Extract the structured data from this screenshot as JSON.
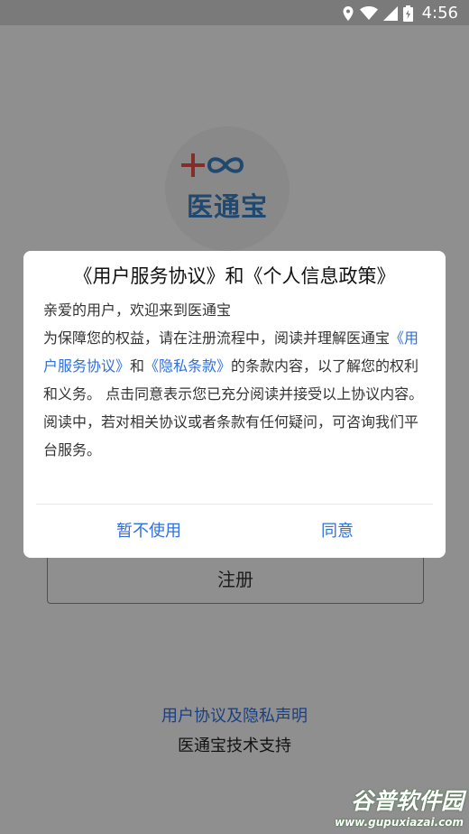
{
  "status_bar": {
    "time": "4:56",
    "icons": [
      "location-icon",
      "wifi-icon",
      "cell-signal-icon",
      "battery-icon"
    ]
  },
  "app": {
    "logo_text": "医通宝",
    "register_label": "注册",
    "footer_link": "用户协议及隐私声明",
    "footer_support": "医通宝技术支持"
  },
  "dialog": {
    "title": "《用户服务协议》和《个人信息政策》",
    "greeting": "亲爱的用户，欢迎来到医通宝",
    "paragraph_lead": "为保障您的权益，请在注册流程中，阅读并理解医通宝",
    "link_user_agreement": "《用户服务协议》",
    "connector": "和",
    "link_privacy": "《隐私条款》",
    "paragraph_tail": "的条款内容，以了解您的权利和义务。 点击同意表示您已充分阅读并接受以上协议内容。阅读中，若对相关协议或者条款有任何疑问，可咨询我们平台服务。",
    "decline_label": "暂不使用",
    "agree_label": "同意"
  },
  "watermark": {
    "title": "谷普软件园",
    "url": "www.gupuxiazai.com"
  },
  "colors": {
    "accent": "#2f6fe0",
    "logo_red": "#e2504a",
    "logo_blue": "#3a7fc0",
    "overlay": "rgba(0,0,0,0.42)"
  }
}
